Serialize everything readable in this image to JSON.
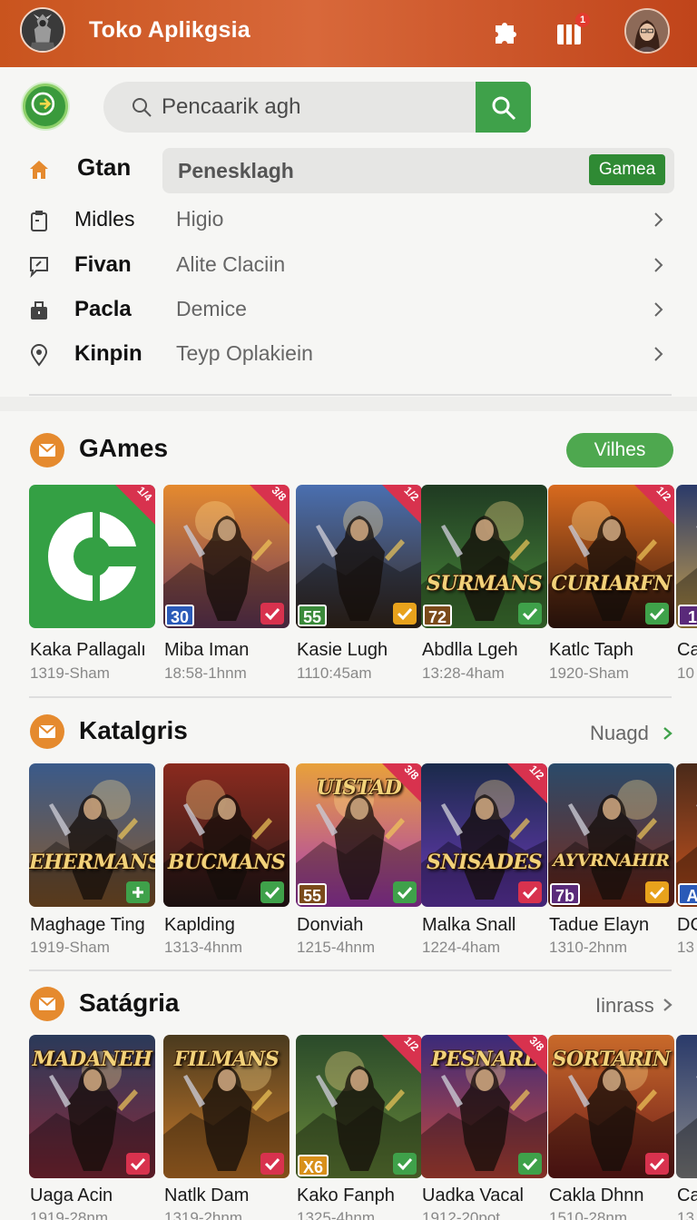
{
  "header": {
    "title": "Toko Aplikgsia",
    "notif_count": "1",
    "icons": [
      "warrior-logo",
      "puzzle-icon",
      "gift-icon",
      "user-avatar"
    ]
  },
  "search": {
    "placeholder": "Pencaarik agh",
    "button_icon": "search-icon"
  },
  "nav": {
    "items": [
      {
        "icon": "home-icon",
        "label": "Gtan",
        "sub": "Penesklagh",
        "tag": "Gamea",
        "selected": true
      },
      {
        "icon": "clipboard-icon",
        "label": "Midles",
        "sub": "Higio"
      },
      {
        "icon": "chat-icon",
        "label": "Fivan",
        "sub": "Alite Claciin"
      },
      {
        "icon": "briefcase-icon",
        "label": "Pacla",
        "sub": "Demice"
      },
      {
        "icon": "location-pin-icon",
        "label": "Kinpin",
        "sub": "Teyp Oplakiein"
      }
    ]
  },
  "sections": [
    {
      "title": "GAmes",
      "more": "Vilhes",
      "cards": [
        {
          "name": "Kaka Pallagalı",
          "meta": "1319-Sham",
          "rating": "",
          "ribbon": "1/4",
          "banner": "",
          "check": ""
        },
        {
          "name": "Miba Iman",
          "meta": "18:58-1hnm",
          "rating": "30",
          "ribbon": "3/8",
          "banner": "",
          "check": "red"
        },
        {
          "name": "Kasie Lugh",
          "meta": "1110:45am",
          "rating": "55",
          "ribbon": "1/2",
          "banner": "",
          "check": "yellow"
        },
        {
          "name": "Abdlla Lgeh",
          "meta": "13:28-4ham",
          "rating": "72",
          "ribbon": "",
          "banner": "SURMANS",
          "check": "green"
        },
        {
          "name": "Katlc Taph",
          "meta": "1920-Sham",
          "rating": "",
          "ribbon": "1/2",
          "banner": "CURIARFN",
          "check": "green"
        },
        {
          "name": "Ca",
          "meta": "10",
          "rating": "1",
          "ribbon": "",
          "banner": "",
          "check": ""
        }
      ]
    },
    {
      "title": "Katalgris",
      "more": "Nuagd",
      "cards": [
        {
          "name": "Maghage Ting",
          "meta": "1919-Sham",
          "rating": "",
          "ribbon": "",
          "banner": "EHERMANS",
          "check": "green-plus"
        },
        {
          "name": "Kaplding",
          "meta": "1313-4hnm",
          "rating": "",
          "ribbon": "",
          "banner": "BUCMANS",
          "check": "green"
        },
        {
          "name": "Donviah",
          "meta": "1215-4hnm",
          "rating": "55",
          "ribbon": "3/8",
          "banner": "UISTAD",
          "check": "green"
        },
        {
          "name": "Malka Snall",
          "meta": "1224-4ham",
          "rating": "",
          "ribbon": "1/2",
          "banner": "SNISADES",
          "check": "red"
        },
        {
          "name": "Tadue Elayn",
          "meta": "1310-2hnm",
          "rating": "7b",
          "ribbon": "",
          "banner": "AYVRNAHIR",
          "check": "yellow"
        },
        {
          "name": "DC",
          "meta": "13",
          "rating": "A",
          "ribbon": "",
          "banner": "",
          "check": ""
        }
      ]
    },
    {
      "title": "Satágria",
      "more": "Iinrass",
      "cards": [
        {
          "name": "Uaga Acin",
          "meta": "1919-28nm",
          "rating": "",
          "ribbon": "",
          "banner": "MADANEH",
          "check": "red"
        },
        {
          "name": "Natlk Dam",
          "meta": "1319-2hnm",
          "rating": "",
          "ribbon": "",
          "banner": "FILMANS",
          "check": "red"
        },
        {
          "name": "Kako Fanph",
          "meta": "1325-4hnm",
          "rating": "X6",
          "ribbon": "1/2",
          "banner": "",
          "check": "green"
        },
        {
          "name": "Uadka Vacal",
          "meta": "1912-20pot",
          "rating": "",
          "ribbon": "3/8",
          "banner": "PESNARL",
          "check": "green"
        },
        {
          "name": "Cakla Dhnn",
          "meta": "1510-28nm",
          "rating": "",
          "ribbon": "",
          "banner": "SORTARIN",
          "check": "red"
        },
        {
          "name": "Ca",
          "meta": "13",
          "rating": "",
          "ribbon": "",
          "banner": "",
          "check": ""
        }
      ]
    }
  ],
  "colors": {
    "header": "#c9541e",
    "accent_green": "#3fa14a",
    "section_icon": "#e58a2e",
    "check_red": "#d8324e",
    "check_green": "#3fa14a",
    "check_yellow": "#e8a21c"
  }
}
